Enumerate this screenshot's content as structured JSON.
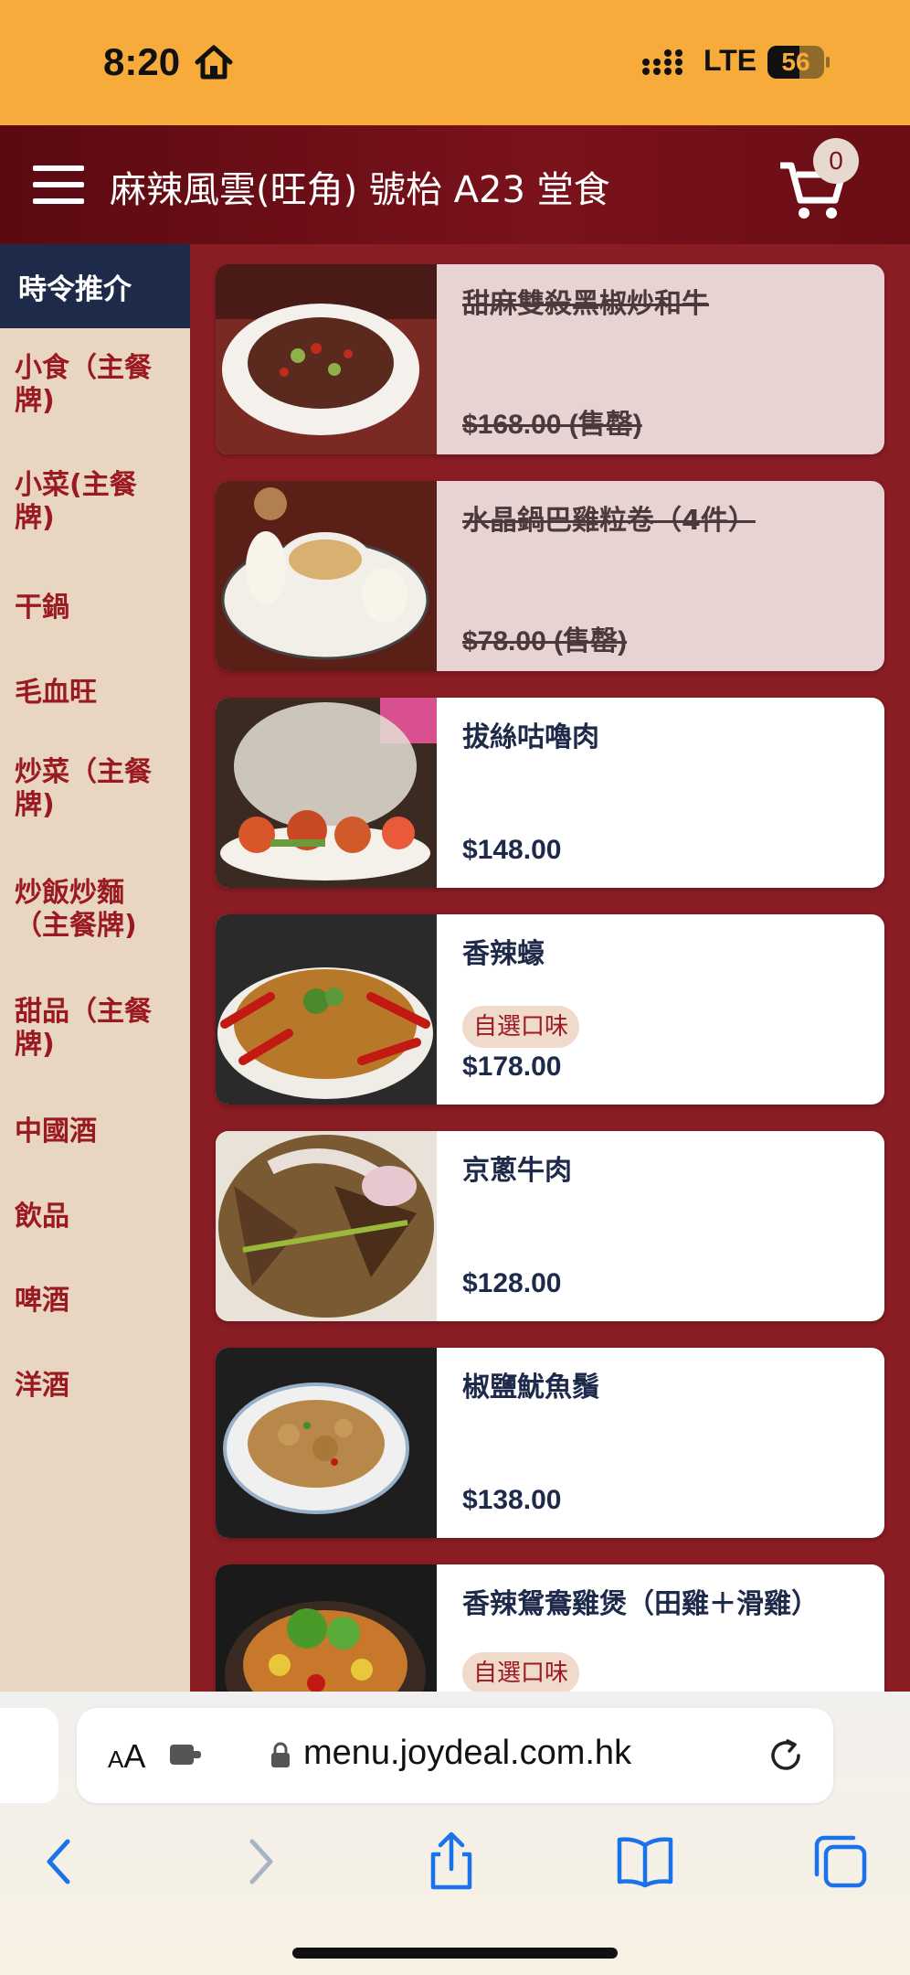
{
  "status_bar": {
    "time": "8:20",
    "network": "LTE",
    "battery": "56",
    "battery_level": 0.56
  },
  "header": {
    "title": "麻辣風雲(旺角) 號枱 A23 堂食",
    "cart_count": "0"
  },
  "sidebar": {
    "active": "時令推介",
    "items": [
      "小食（主餐牌)",
      "小菜(主餐牌)",
      "干鍋",
      "毛血旺",
      "炒菜（主餐牌)",
      "炒飯炒麵（主餐牌)",
      "甜品（主餐牌)",
      "中國酒",
      "飲品",
      "啤酒",
      "洋酒"
    ]
  },
  "menu_items": [
    {
      "name": "甜麻雙殺黑椒炒和牛",
      "price": "$168.00 (售罄)",
      "sold_out": true,
      "tag": ""
    },
    {
      "name": "水晶鍋巴雞粒卷（4件）",
      "price": "$78.00 (售罄)",
      "sold_out": true,
      "tag": ""
    },
    {
      "name": "拔絲咕嚕肉",
      "price": "$148.00",
      "sold_out": false,
      "tag": ""
    },
    {
      "name": "香辣蠔",
      "price": "$178.00",
      "sold_out": false,
      "tag": "自選口味"
    },
    {
      "name": "京蔥牛肉",
      "price": "$128.00",
      "sold_out": false,
      "tag": ""
    },
    {
      "name": "椒鹽魷魚鬚",
      "price": "$138.00",
      "sold_out": false,
      "tag": ""
    },
    {
      "name": "香辣鴛鴦雞煲（田雞＋滑雞）",
      "price": "",
      "sold_out": false,
      "tag": "自選口味"
    }
  ],
  "browser": {
    "aa_small": "A",
    "aa_big": "A",
    "url": "menu.joydeal.com.hk"
  },
  "icons": {
    "menu": "hamburger-icon",
    "cart": "cart-icon",
    "back": "chevron-left-icon",
    "forward": "chevron-right-icon",
    "share": "share-icon",
    "bookmarks": "book-icon",
    "tabs": "tabs-icon"
  },
  "colors": {
    "status_bar": "#f6ab3b",
    "header": "#7a121b",
    "content_bg": "#8a1c24",
    "sidebar_bg": "#e8d6c2",
    "sidebar_active": "#1e2a4a",
    "accent_text": "#9b1a22",
    "browser_blue": "#1a73e8"
  }
}
